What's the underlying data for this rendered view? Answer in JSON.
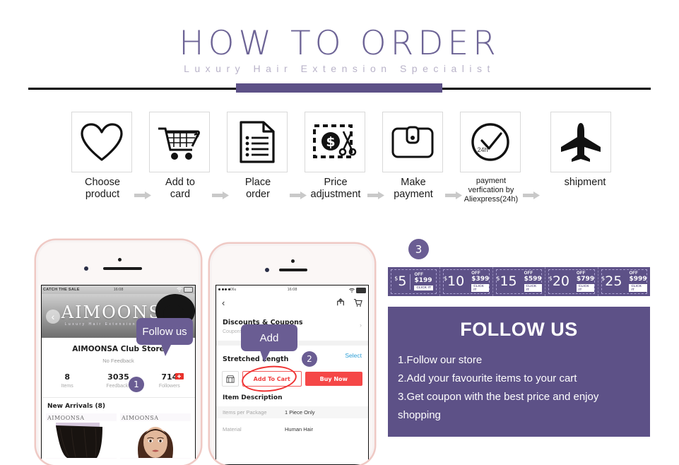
{
  "header": {
    "title": "HOW TO ORDER",
    "subtitle": "Luxury Hair Extension Specialist"
  },
  "steps": [
    {
      "label_line1": "Choose",
      "label_line2": "product",
      "icon": "heart-icon"
    },
    {
      "label_line1": "Add to",
      "label_line2": "card",
      "icon": "shopping-cart-icon"
    },
    {
      "label_line1": "Place",
      "label_line2": "order",
      "icon": "document-list-icon"
    },
    {
      "label_line1": "Price",
      "label_line2": "adjustment",
      "icon": "price-cut-dollar-icon"
    },
    {
      "label_line1": "Make",
      "label_line2": "payment",
      "icon": "wallet-icon"
    },
    {
      "label_line1": "payment",
      "label_line2": "verfication by",
      "label_line3": "Aliexpress(24h)",
      "icon": "clock-check-icon",
      "icon_text": "24h"
    },
    {
      "label_line1": "shipment",
      "label_line2": "",
      "icon": "airplane-icon"
    }
  ],
  "phone1": {
    "status": {
      "carrier": "CATCH THE SALE",
      "time": "16:08"
    },
    "brand": "AIMOONSA",
    "brand_sub": "Luxury Hair Extension Specialist",
    "store_name": "AIMOONSA Club Store",
    "feedback": "No Feedback",
    "stats": [
      {
        "value": "8",
        "label": "Items"
      },
      {
        "value": "3035",
        "label": "Feedbacks"
      },
      {
        "value": "714",
        "label": "Followers"
      }
    ],
    "new_arrivals": "New Arrivals (8)",
    "card_brand": "AIMOONSA",
    "bubble": "Follow us",
    "badge": "1"
  },
  "phone2": {
    "status": {
      "carrier": "06u",
      "time": "16:08"
    },
    "section_title": "Discounts & Coupons",
    "section_sub": "Coupons",
    "row_label": "Stretched Length",
    "select_label": "Select",
    "add_to_cart": "Add To Cart",
    "buy_now": "Buy Now",
    "item_description": "Item Description",
    "desc_rows": [
      {
        "key": "Items per Package",
        "value": "1 Piece Only"
      },
      {
        "key": "Material",
        "value": "Human Hair"
      }
    ],
    "bubble": "Add",
    "badge": "2"
  },
  "coupons": {
    "badge": "3",
    "items": [
      {
        "amount": "5",
        "currency": "$",
        "off": "OFF",
        "min": "$199",
        "button": "CLICK IT"
      },
      {
        "amount": "10",
        "currency": "$",
        "off": "OFF",
        "min": "$399",
        "button": "CLICK IT"
      },
      {
        "amount": "15",
        "currency": "$",
        "off": "OFF",
        "min": "$599",
        "button": "CLICK IT"
      },
      {
        "amount": "20",
        "currency": "$",
        "off": "OFF",
        "min": "$799",
        "button": "CLICK IT"
      },
      {
        "amount": "25",
        "currency": "$",
        "off": "OFF",
        "min": "$999",
        "button": "CLICK IT"
      }
    ]
  },
  "follow": {
    "title": "FOLLOW US",
    "lines": [
      "1.Follow our store",
      "2.Add your favourite items to your cart",
      "3.Get coupon with the best price and enjoy",
      "shopping"
    ]
  },
  "colors": {
    "purple": "#5d5187",
    "bubble_purple": "#6a5d93",
    "title_purple": "#6d6496",
    "subtitle_gray": "#b9b3c9",
    "red": "#f54747",
    "rose_gold": "#efc9c4"
  }
}
